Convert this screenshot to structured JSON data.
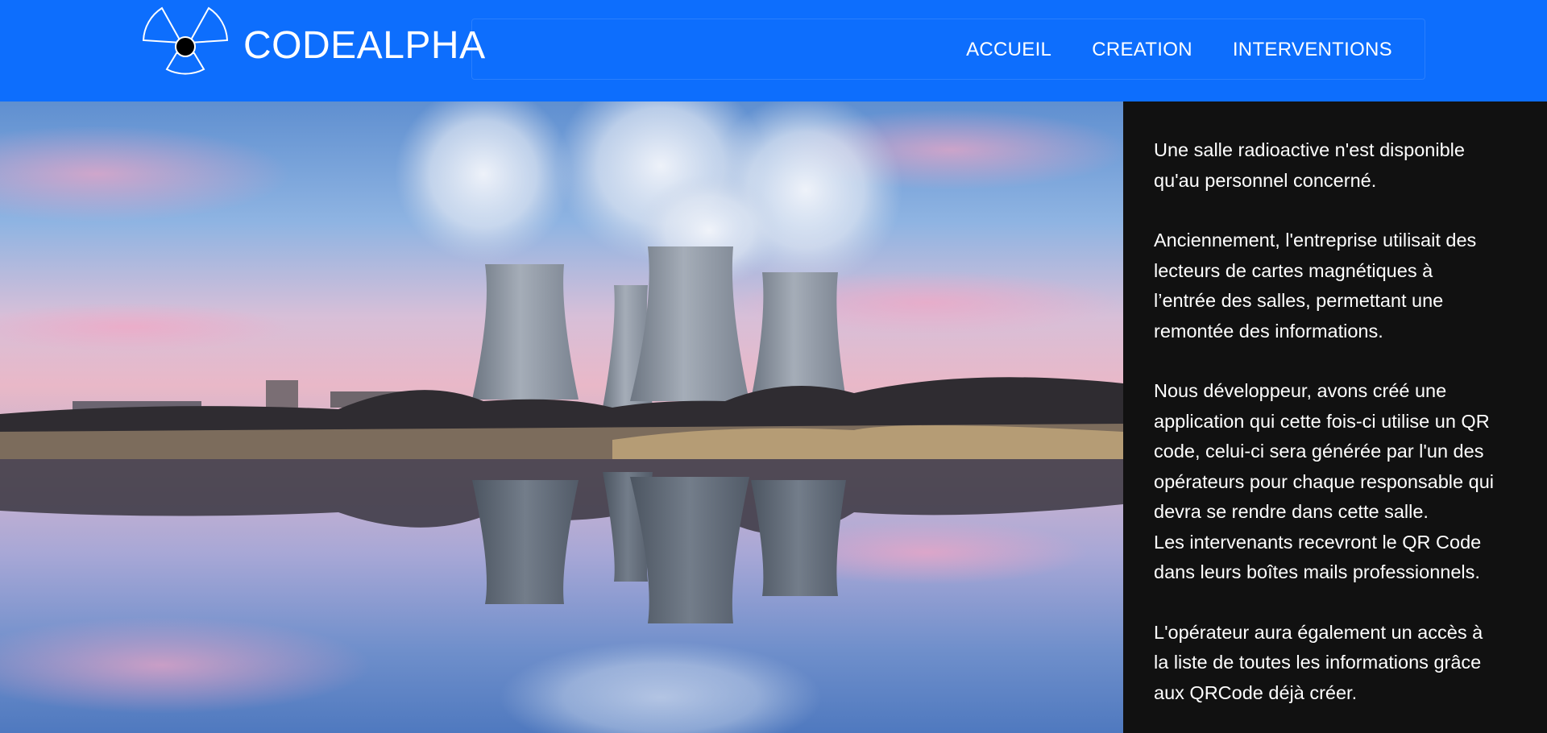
{
  "brand": {
    "name": "CODEALPHA",
    "logo_icon": "radiation-trefoil-icon"
  },
  "nav": {
    "links": [
      {
        "label": "ACCUEIL"
      },
      {
        "label": "CREATION"
      },
      {
        "label": "INTERVENTIONS"
      }
    ]
  },
  "hero": {
    "image": "nuclear-cooling-towers-lake-reflection"
  },
  "info": {
    "p1": [
      "Une salle radioactive n'est disponible",
      "qu'au personnel concerné."
    ],
    "p2": [
      "Anciennement, l'entreprise utilisait des",
      "lecteurs de cartes magnétiques à",
      "l’entrée des salles, permettant une",
      "remontée des informations."
    ],
    "p3": [
      "Nous développeur, avons créé une",
      "application qui cette fois-ci utilise un QR",
      "code, celui-ci sera générée par l'un des",
      "opérateurs pour chaque responsable qui",
      "devra se rendre dans cette salle.",
      "Les intervenants recevront le QR Code",
      "dans leurs boîtes mails professionnels."
    ],
    "p4": [
      "L'opérateur aura également un accès à",
      "la liste de toutes les informations grâce",
      "aux QRCode déjà créer."
    ]
  },
  "colors": {
    "navbar": "#0d6efd",
    "sidebar": "#111111",
    "text": "#ffffff"
  }
}
